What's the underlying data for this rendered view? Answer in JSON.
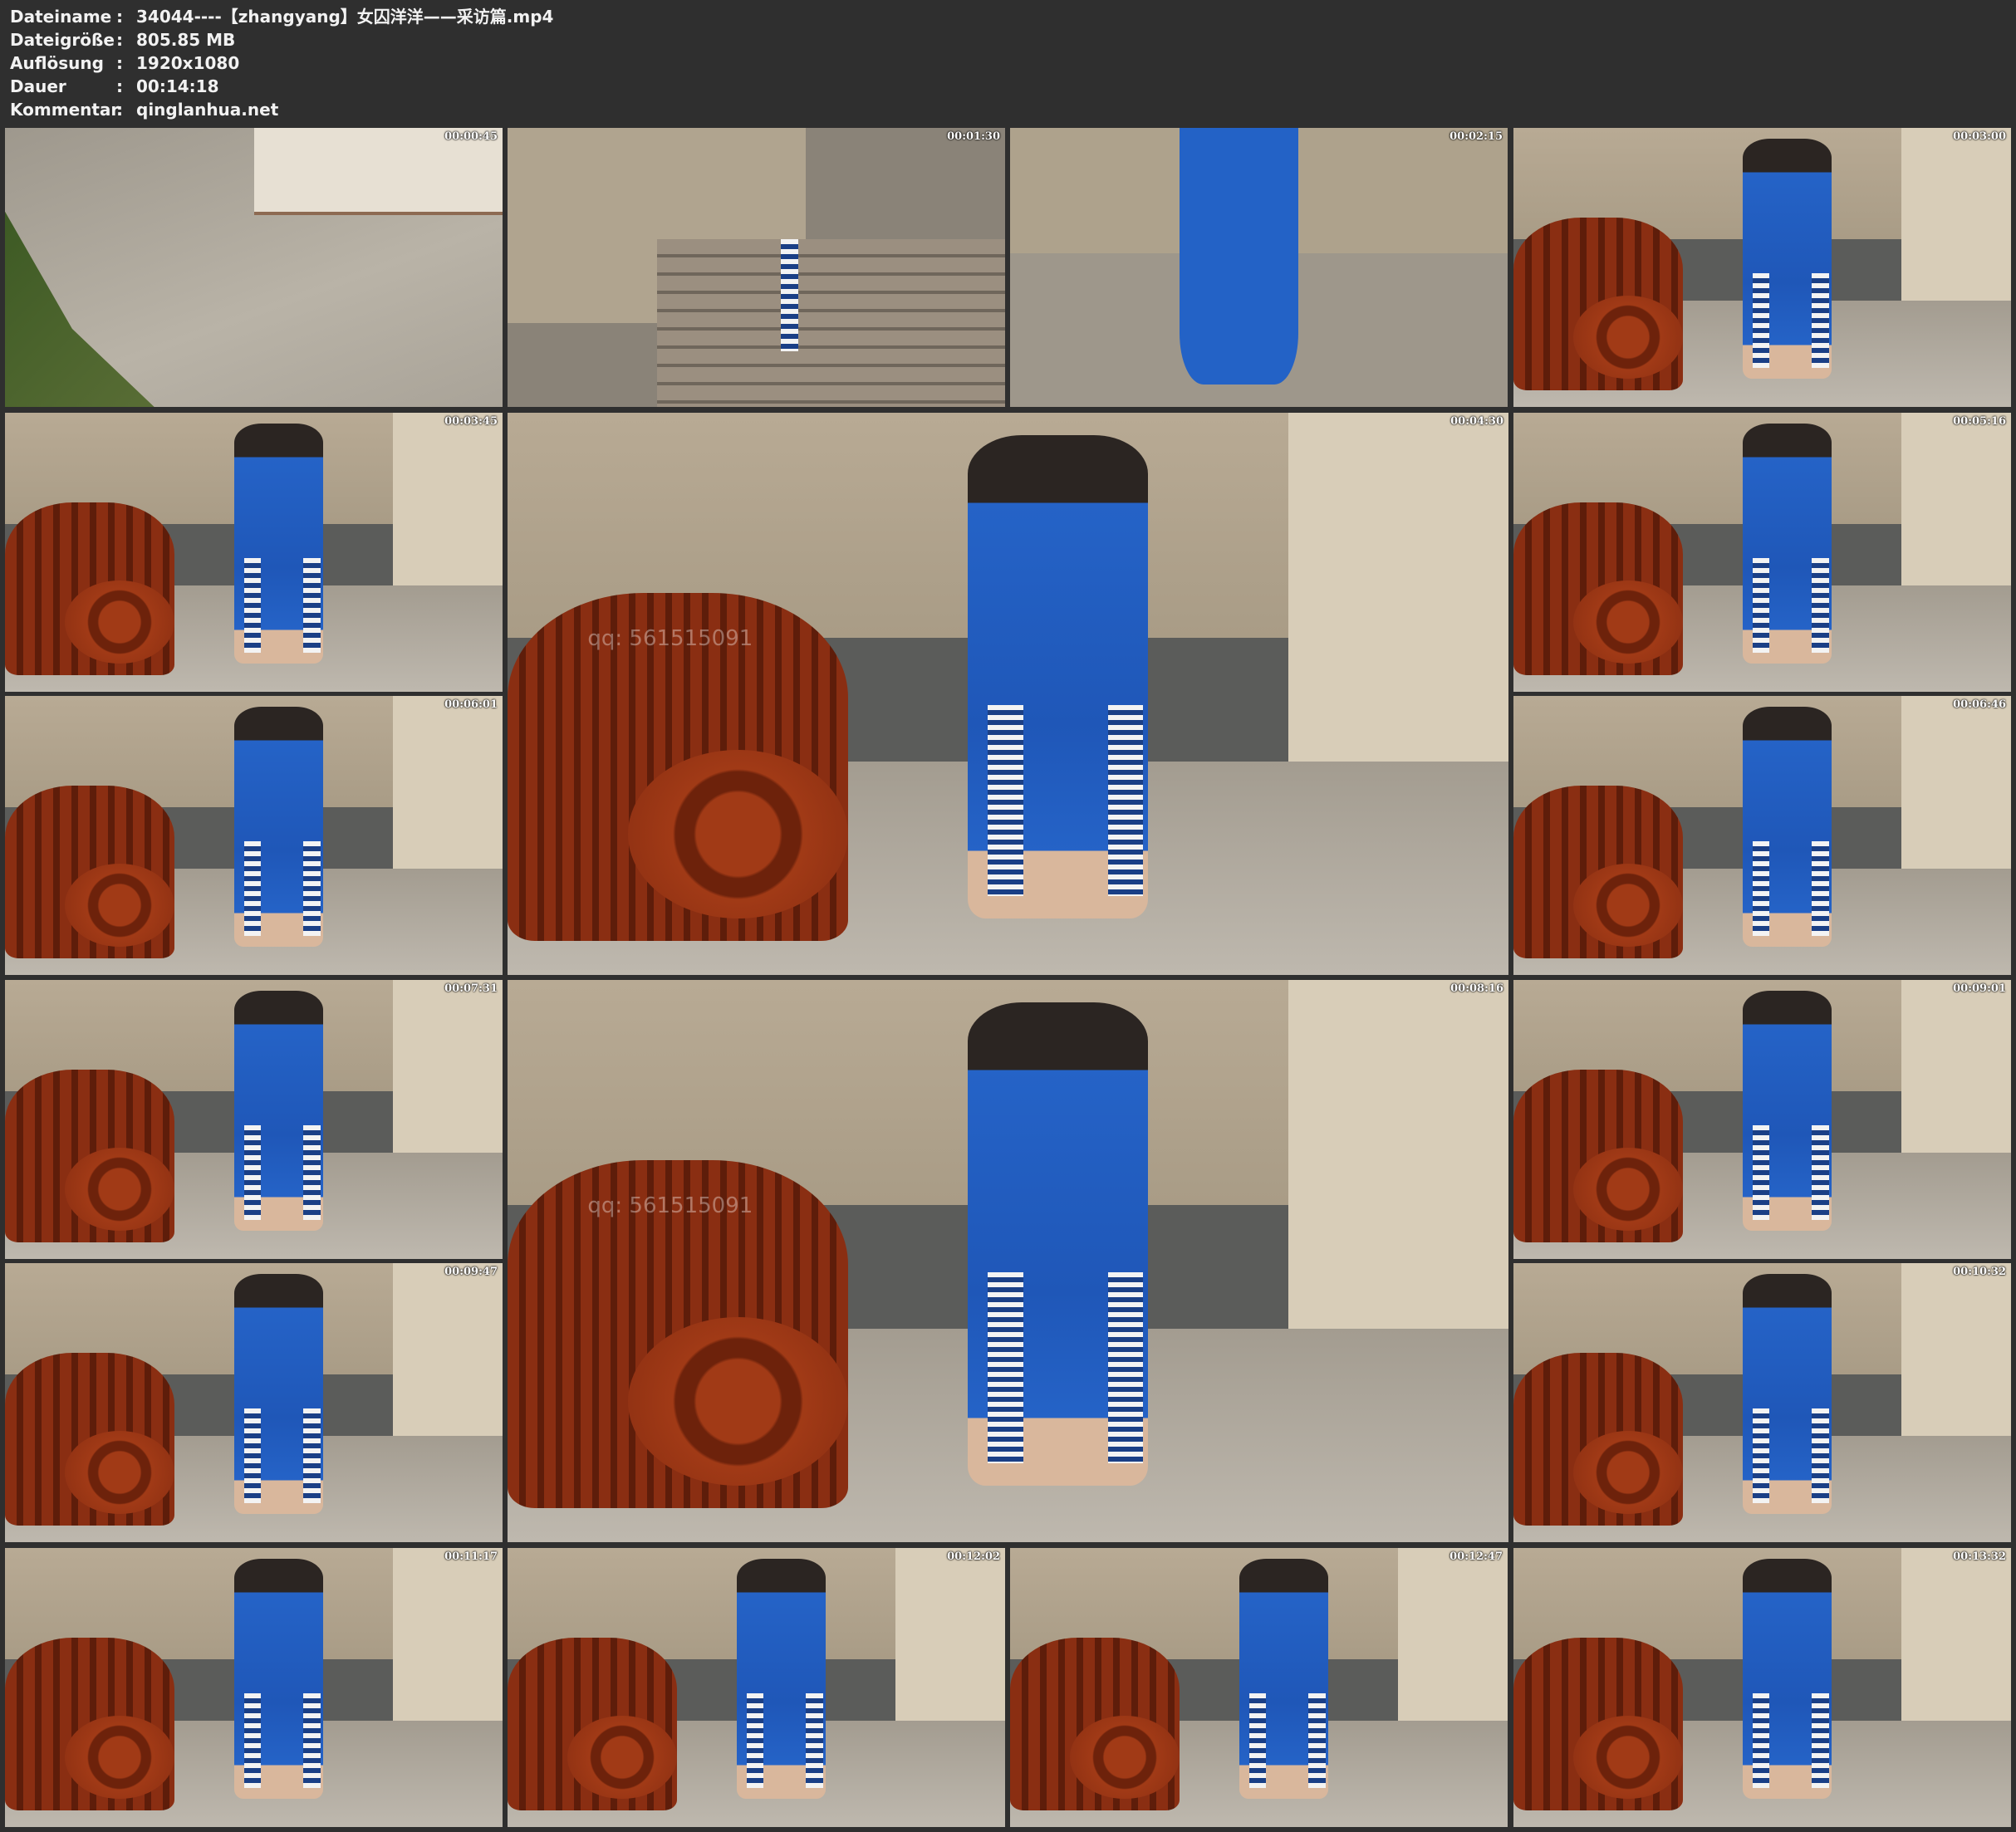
{
  "header": {
    "rows": [
      {
        "key": "Dateiname",
        "sep": ":",
        "value": "34044----【zhangyang】女囚洋洋——采访篇.mp4"
      },
      {
        "key": "Dateigröße",
        "sep": ":",
        "value": "805.85 MB"
      },
      {
        "key": "Auflösung",
        "sep": ":",
        "value": "1920x1080"
      },
      {
        "key": "Dauer",
        "sep": ":",
        "value": "00:14:18"
      },
      {
        "key": "Kommentar",
        "sep": ":",
        "value": "qinglanhua.net"
      }
    ]
  },
  "thumbnails": [
    {
      "timestamp": "00:00:45",
      "scene": "outdoor"
    },
    {
      "timestamp": "00:01:30",
      "scene": "stairs"
    },
    {
      "timestamp": "00:02:15",
      "scene": "stand"
    },
    {
      "timestamp": "00:03:00",
      "scene": "seated"
    },
    {
      "timestamp": "00:03:45",
      "scene": "seated"
    },
    {
      "timestamp": "00:04:30",
      "scene": "seated",
      "watermark": "qq: 561515091"
    },
    {
      "timestamp": "00:05:16",
      "scene": "seated"
    },
    {
      "timestamp": "00:06:01",
      "scene": "seated"
    },
    {
      "timestamp": "00:06:46",
      "scene": "seated"
    },
    {
      "timestamp": "00:07:31",
      "scene": "seated"
    },
    {
      "timestamp": "00:08:16",
      "scene": "seated",
      "watermark": "qq: 561515091"
    },
    {
      "timestamp": "00:09:01",
      "scene": "seated"
    },
    {
      "timestamp": "00:09:47",
      "scene": "seated"
    },
    {
      "timestamp": "00:10:32",
      "scene": "seated"
    },
    {
      "timestamp": "00:11:17",
      "scene": "seated"
    },
    {
      "timestamp": "00:12:02",
      "scene": "seated"
    },
    {
      "timestamp": "00:12:47",
      "scene": "seated"
    },
    {
      "timestamp": "00:13:32",
      "scene": "seated"
    }
  ]
}
